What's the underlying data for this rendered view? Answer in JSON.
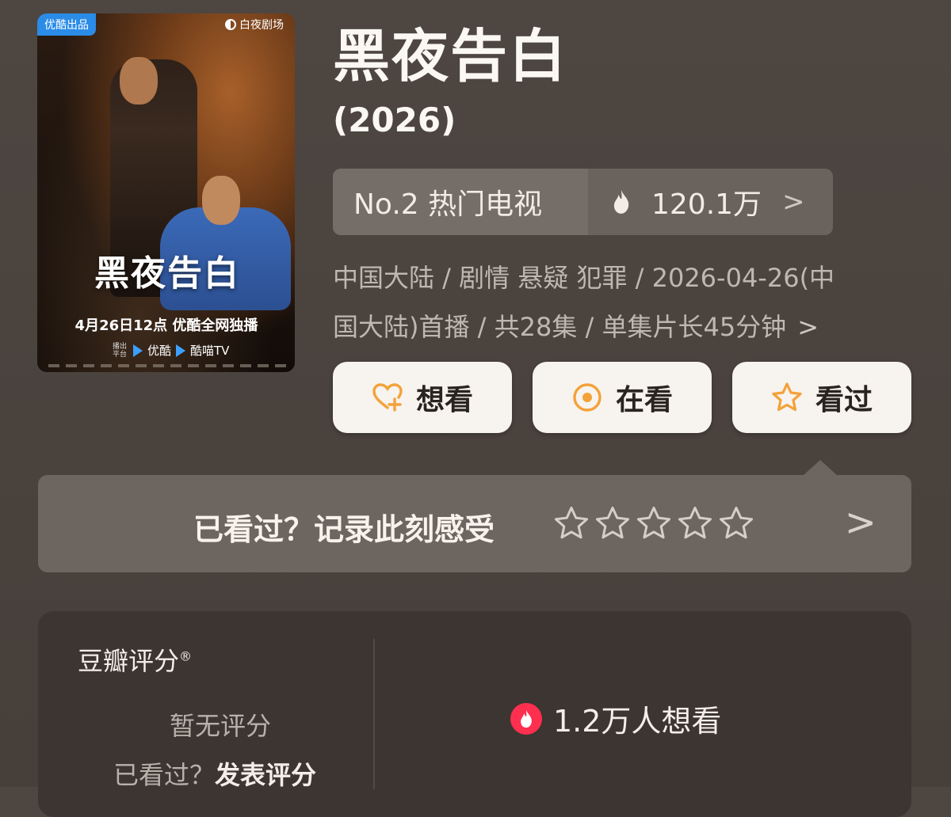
{
  "poster": {
    "badge": "优酷出品",
    "studio": "白夜剧场",
    "title": "黑夜告白",
    "date_line": "4月26日12点 优酷全网独播",
    "platform_prefix": "播出平台",
    "platforms": [
      "优酷",
      "酷喵TV"
    ]
  },
  "title": "黑夜告白",
  "year": "(2026)",
  "rank": {
    "label": "No.2 热门电视",
    "heat": "120.1万",
    "icon": "fire-icon"
  },
  "meta": {
    "line1": "中国大陆 / 剧情 悬疑 犯罪 / 2026-04-26(中",
    "line2": "国大陆)首播 / 共28集 / 单集片长45分钟"
  },
  "actions": {
    "want": "想看",
    "watching": "在看",
    "watched": "看过"
  },
  "rate_prompt": {
    "text": "已看过？记录此刻感受",
    "stars": 5,
    "filled": 0
  },
  "rating": {
    "label": "豆瓣评分",
    "mark": "®",
    "empty": "暂无评分",
    "seen_prefix": "已看过？",
    "seen_link": "发表评分",
    "wants": "1.2万人想看"
  },
  "colors": {
    "accent": "#f3a23a",
    "poster_badge": "#2b8ce8",
    "wants_icon": "#ff2f4f"
  }
}
